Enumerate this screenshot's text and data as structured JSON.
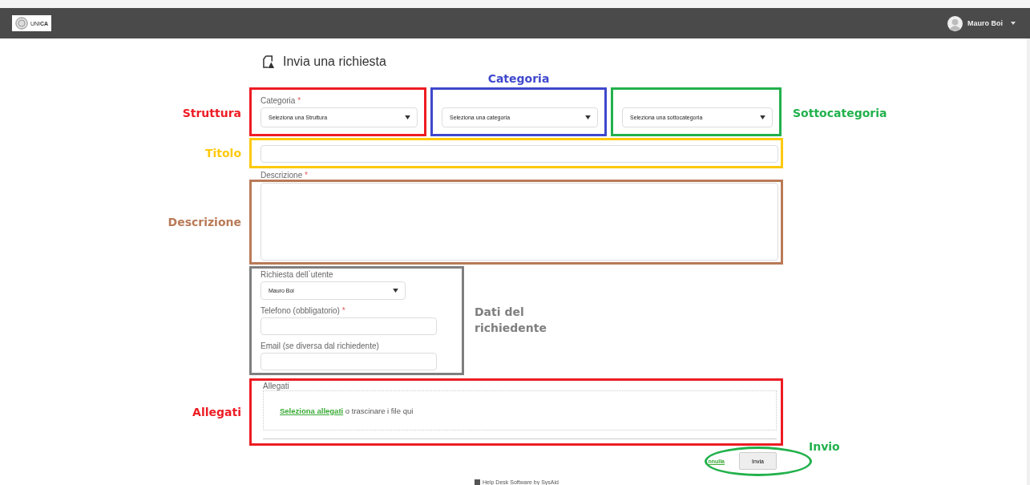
{
  "navbar": {
    "logo_text": "UNI**CA**",
    "user_name": "Mauro Boi"
  },
  "page_title": "Invia una richiesta",
  "classification": {
    "fields": [
      {
        "label": "Categoria",
        "required_mark": "*",
        "value": "Seleziona una Struttura",
        "annotation": {
          "text": "Struttura",
          "color": "#ed1c24",
          "kind": "left"
        }
      },
      {
        "value": "Seleziona una categoria",
        "annotation": {
          "text": "Categoria",
          "color": "#3f48cc",
          "kind": "top"
        }
      },
      {
        "value": "Seleziona una sottocategoria",
        "annotation": {
          "text": "Sottocategoria",
          "color": "#22b14c",
          "kind": "right"
        }
      }
    ]
  },
  "title_field": {
    "annotation": {
      "text": "Titolo",
      "color": "#ffc90e"
    }
  },
  "description": {
    "label": "Descrizione",
    "required_mark": "*",
    "annotation": {
      "text": "Descrizione",
      "color": "#b97a57"
    }
  },
  "requester": {
    "annotation": {
      "text": "Dati del richiedente",
      "color": "#7f7f7f"
    },
    "fields": [
      {
        "kind": "select",
        "label": "Richiesta dell`utente",
        "value": "Mauro Boi"
      },
      {
        "kind": "input",
        "label": "Telefono (obbligatorio)",
        "required_mark": "*"
      },
      {
        "kind": "input",
        "label": "Email (se diversa dal richiedente)"
      }
    ]
  },
  "attachments": {
    "label": "Allegati",
    "link": "Seleziona allegati",
    "text": "o trascinare i file qui",
    "annotation": {
      "text": "Allegati",
      "color": "#ed1c24"
    }
  },
  "actions": {
    "cancel": "nnulla",
    "submit": "Invia",
    "annotation": {
      "text": "Invio",
      "color": "#22b14c"
    }
  },
  "footer": "Help Desk Software by SysAid"
}
